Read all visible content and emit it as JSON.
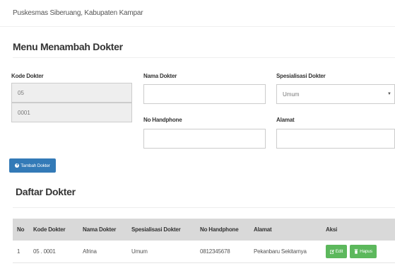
{
  "header": {
    "breadcrumb": "Puskesmas Siberuang, Kabupaten Kampar"
  },
  "form": {
    "title": "Menu Menambah Dokter",
    "kode_dokter_label": "Kode Dokter",
    "kode_prefix_value": "05",
    "kode_number_value": "0001",
    "nama_dokter_label": "Nama Dokter",
    "nama_dokter_value": "",
    "spesialisasi_label": "Spesialisasi Dokter",
    "spesialisasi_selected": "Umum",
    "no_handphone_label": "No Handphone",
    "no_handphone_value": "",
    "alamat_label": "Alamat",
    "alamat_value": "",
    "add_button_label": "Tambah Dokter",
    "add_button_icon": "plus-circle-icon"
  },
  "list": {
    "title": "Daftar Dokter",
    "columns": [
      "No",
      "Kode Dokter",
      "Nama Dokter",
      "Spesialisasi Dokter",
      "No Handphone",
      "Alamat",
      "Aksi"
    ],
    "rows": [
      {
        "no": "1",
        "kode": "05 . 0001",
        "nama": "Afrina",
        "spesialisasi": "Umum",
        "handphone": "0812345678",
        "alamat": "Pekanbaru Sekitarnya",
        "edit_label": "Edit",
        "hapus_label": "Hapus"
      }
    ]
  },
  "colors": {
    "primary": "#337ab7",
    "success": "#5cb85c",
    "header_bg": "#d9d9d9",
    "readonly_bg": "#eeeeee"
  }
}
